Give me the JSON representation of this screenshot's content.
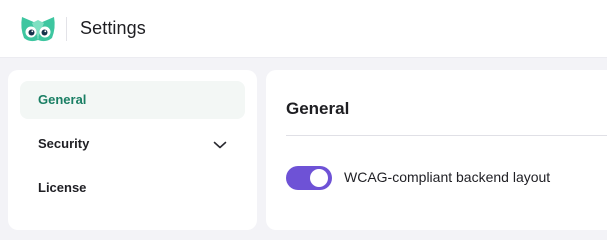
{
  "header": {
    "title": "Settings",
    "logo_icon": "owl-logo-icon",
    "accent_color": "#3ec6a0"
  },
  "sidebar": {
    "items": [
      {
        "label": "General",
        "active": true
      },
      {
        "label": "Security",
        "active": false,
        "icon": "chevron-down-icon"
      },
      {
        "label": "License",
        "active": false
      }
    ],
    "active_color": "#1a7f64"
  },
  "main": {
    "title": "General",
    "settings": [
      {
        "label": "WCAG-compliant backend layout",
        "enabled": true,
        "toggle_color": "#6e52d6"
      }
    ]
  }
}
